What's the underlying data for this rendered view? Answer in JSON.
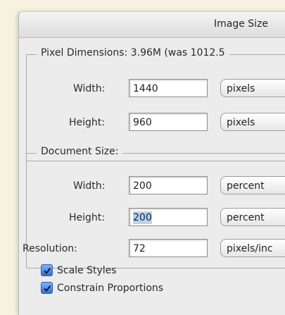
{
  "dialog": {
    "title": "Image Size"
  },
  "pixel_dimensions": {
    "legend": "Pixel Dimensions:  3.96M (was 1012.5",
    "width": {
      "label": "Width:",
      "value": "1440",
      "unit": "pixels"
    },
    "height": {
      "label": "Height:",
      "value": "960",
      "unit": "pixels"
    }
  },
  "document_size": {
    "legend": "Document Size:",
    "width": {
      "label": "Width:",
      "value": "200",
      "unit": "percent"
    },
    "height": {
      "label": "Height:",
      "value": "200",
      "unit": "percent"
    },
    "resolution": {
      "label": "Resolution:",
      "value": "72",
      "unit": "pixels/inc"
    }
  },
  "options": {
    "scale_styles": {
      "label": "Scale Styles",
      "checked": true
    },
    "constrain_proportions": {
      "label": "Constrain Proportions",
      "checked": true
    }
  },
  "colors": {
    "background": "#f6f2df",
    "dialog": "#ececec",
    "checkbox": "#3b7be0",
    "selection": "#b6d3f5"
  }
}
